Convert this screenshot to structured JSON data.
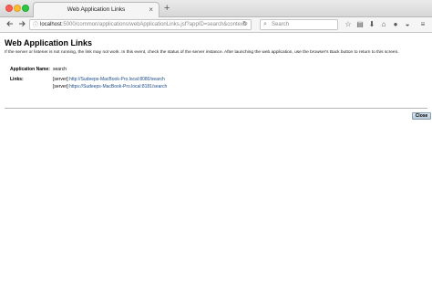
{
  "browser": {
    "tab_title": "Web Application Links",
    "tab_close": "×",
    "new_tab": "+",
    "url_host": "localhost",
    "url_rest": ":5000/common/applications/webApplicationLinks.jsf?appID=search&contextI",
    "search_placeholder": "Search",
    "colors": {
      "close": "#fc5f57",
      "minimize": "#fdbc2e",
      "maximize": "#2ac840"
    }
  },
  "page": {
    "title": "Web Application Links",
    "instructions": "If the server or listener is not running, the link may not work. In this event, check the status of the server instance. After launching the web application, use the browser's Back button to return to this screen.",
    "app_name_label": "Application Name:",
    "app_name_value": "search",
    "links_label": "Links:",
    "links": [
      {
        "prefix": "[server]",
        "url": "http://Sudeeps-MacBook-Pro.local:8080/search"
      },
      {
        "prefix": "[server]",
        "url": "https://Sudeeps-MacBook-Pro.local:8181/search"
      }
    ],
    "close_label": "Close"
  }
}
